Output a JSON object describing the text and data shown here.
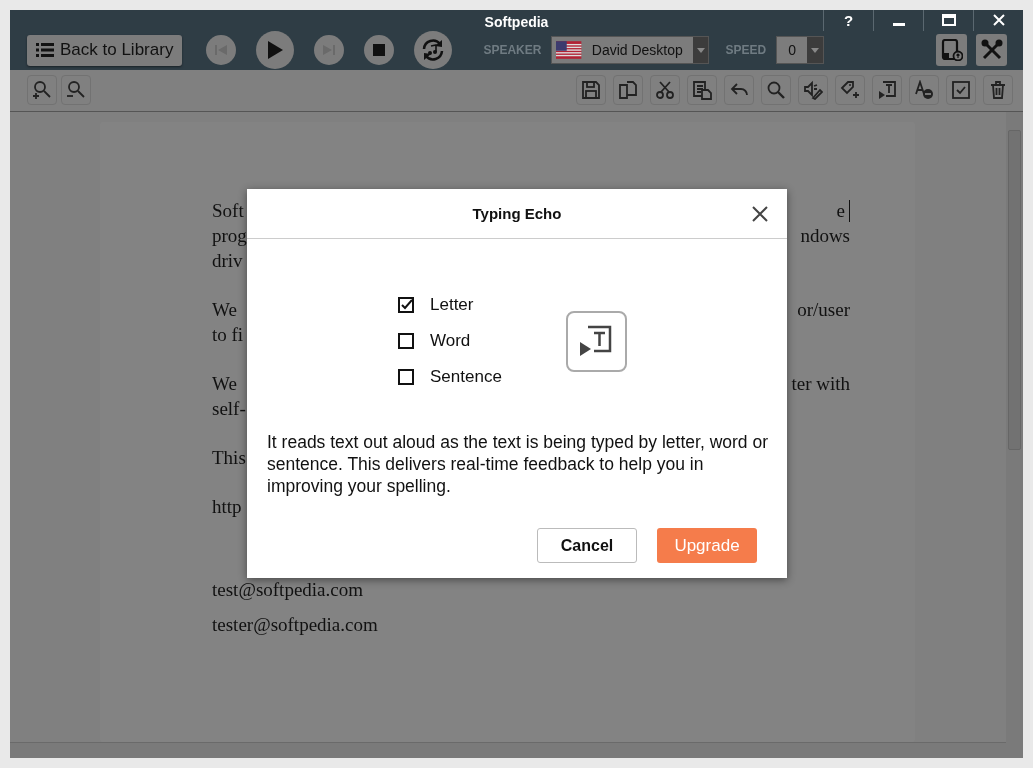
{
  "window": {
    "title": "Softpedia",
    "help": "?"
  },
  "player": {
    "back_button": "Back to Library",
    "speaker_label": "SPEAKER",
    "speaker": "David Desktop",
    "speed_label": "SPEED",
    "speed": "0",
    "transport": [
      {
        "kind": "previous",
        "disabled": true
      },
      {
        "kind": "play",
        "disabled": false
      },
      {
        "kind": "next",
        "disabled": true
      },
      {
        "kind": "stop",
        "disabled": false
      },
      {
        "kind": "repeat",
        "disabled": false
      }
    ]
  },
  "document": {
    "paragraphs": [
      {
        "lines": [
          {
            "left": "Soft",
            "right": "e"
          },
          {
            "left": "prog",
            "right": "ndows"
          },
          {
            "left": "driv"
          }
        ]
      },
      {
        "lines": [
          {
            "left": "We",
            "right": "or/user"
          },
          {
            "left": "to fi"
          }
        ]
      },
      {
        "lines": [
          {
            "left": "We",
            "right": "ter with"
          },
          {
            "left": "self-"
          }
        ]
      },
      {
        "lines": [
          {
            "left": "This"
          }
        ]
      },
      {
        "lines": [
          {
            "left": "http"
          }
        ]
      },
      {
        "lines": [
          {
            "left": "test@softpedia.com"
          }
        ]
      },
      {
        "lines": [
          {
            "left": "tester@softpedia.com"
          }
        ]
      }
    ]
  },
  "dialog": {
    "title": "Typing Echo",
    "options": [
      {
        "label": "Letter",
        "checked": true
      },
      {
        "label": "Word",
        "checked": false
      },
      {
        "label": "Sentence",
        "checked": false
      }
    ],
    "description": "It reads text out aloud as the text is being typed by letter, word or sentence. This delivers real-time feedback to help you in improving your spelling.",
    "buttons": [
      {
        "label": "Cancel",
        "kind": "secondary"
      },
      {
        "label": "Upgrade",
        "kind": "primary"
      }
    ]
  }
}
